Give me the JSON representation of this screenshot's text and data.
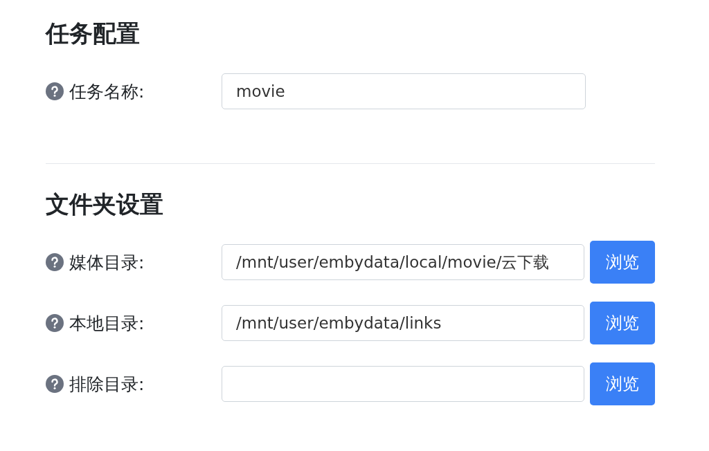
{
  "sections": [
    {
      "title": "任务配置",
      "fields": [
        {
          "label": "任务名称:",
          "value": "movie"
        }
      ]
    },
    {
      "title": "文件夹设置",
      "fields": [
        {
          "label": "媒体目录:",
          "value": "/mnt/user/embydata/local/movie/云下载",
          "browse": "浏览"
        },
        {
          "label": "本地目录:",
          "value": "/mnt/user/embydata/links",
          "browse": "浏览"
        },
        {
          "label": "排除目录:",
          "browse": "浏览"
        }
      ]
    }
  ]
}
